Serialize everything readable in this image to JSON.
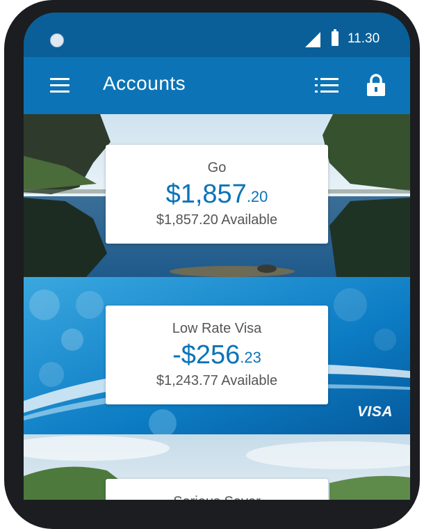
{
  "status_bar": {
    "time": "11.30",
    "icons": [
      "notification-dot-icon",
      "signal-icon",
      "battery-icon"
    ]
  },
  "app_bar": {
    "title": "Accounts",
    "menu_icon": "hamburger-icon",
    "actions": [
      "list-icon",
      "lock-icon"
    ]
  },
  "accounts": [
    {
      "name": "Go",
      "balance_main": "$1,857",
      "balance_cents": ".20",
      "available": "$1,857.20 Available"
    },
    {
      "name": "Low Rate Visa",
      "balance_main": "-$256",
      "balance_cents": ".23",
      "available": "$1,243.77 Available",
      "badge": "VISA"
    },
    {
      "name": "Serious Saver"
    }
  ],
  "colors": {
    "status_bar": "#0a5f98",
    "app_bar": "#0c74b6",
    "accent_text": "#0a73b7",
    "frame": "#1b1d20"
  }
}
